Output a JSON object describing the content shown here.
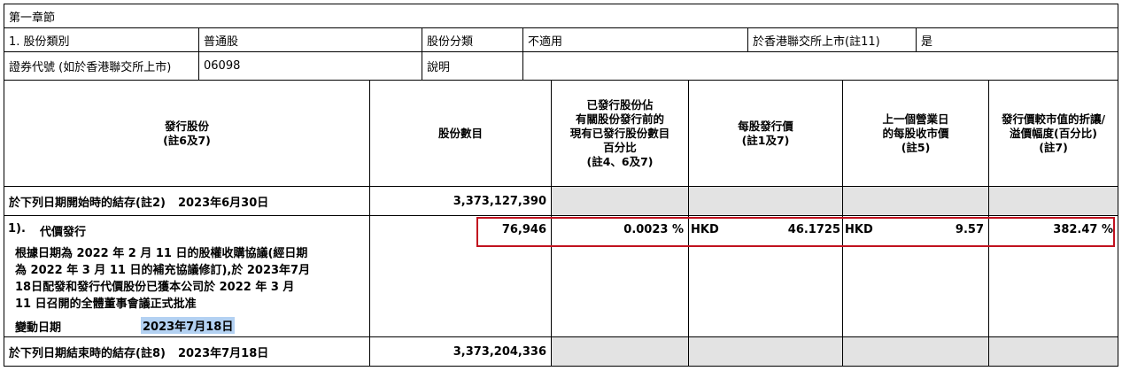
{
  "section_title": "第一章節",
  "row1": {
    "share_class_label": "1. 股份類別",
    "share_class_value": "普通股",
    "share_category_label": "股份分類",
    "share_category_value": "不適用",
    "listed_label": "於香港聯交所上市(註11)",
    "listed_value": "是"
  },
  "row2": {
    "stock_code_label": "證券代號 (如於香港聯交所上市)",
    "stock_code_value": "06098",
    "description_label": "說明",
    "description_value": ""
  },
  "headers": {
    "issued_shares": [
      "發行股份",
      "(註6及7)"
    ],
    "share_count": [
      "股份數目"
    ],
    "pct_issued": [
      "已發行股份佔",
      "有關股份發行前的",
      "現有已發行股份數目",
      "百分比",
      "(註4、6及7)"
    ],
    "issue_price": [
      "每股發行價",
      "(註1及7)"
    ],
    "closing_price": [
      "上一個營業日",
      "的每股收市價",
      "(註5)"
    ],
    "discount": [
      "發行價較市值的折讓/",
      "溢價幅度(百分比)",
      "(註7)"
    ]
  },
  "opening": {
    "label": "於下列日期開始時的結存(註2)",
    "date": "2023年6月30日",
    "shares": "3,373,127,390"
  },
  "movement": {
    "number": "1).",
    "type": "代價發行",
    "description": [
      "根據日期為 2022 年 2 月 11 日的股權收購協議(經日期",
      "為 2022 年 3 月 11 日的補充協議修訂),於 2023年7月",
      "18日配發和發行代價股份已獲本公司於 2022 年 3 月",
      "11 日召開的全體董事會議正式批准"
    ],
    "change_date_label": "變動日期",
    "change_date": "2023年7月18日",
    "shares": "76,946",
    "pct": "0.0023 %",
    "issue_currency": "HKD",
    "issue_price": "46.1725",
    "close_currency": "HKD",
    "close_price": "9.57",
    "discount": "382.47 %"
  },
  "closing": {
    "label": "於下列日期結束時的結存(註8)",
    "date": "2023年7月18日",
    "shares": "3,373,204,336"
  },
  "colors": {
    "highlight_box": "#c1121f",
    "gray_cell": "#e3e3e3",
    "date_highlight": "#b3d1f2"
  }
}
